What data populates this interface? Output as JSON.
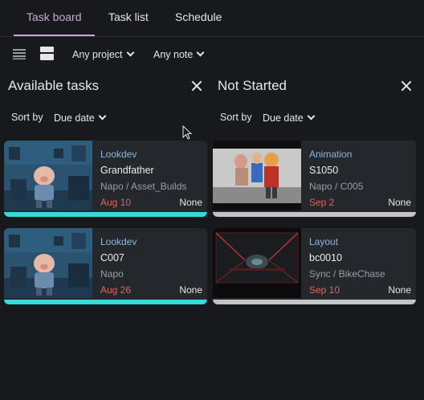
{
  "tabs": [
    {
      "label": "Task board",
      "active": true
    },
    {
      "label": "Task list",
      "active": false
    },
    {
      "label": "Schedule",
      "active": false
    }
  ],
  "toolbar": {
    "project_filter": "Any project",
    "note_filter": "Any note"
  },
  "columns": [
    {
      "title": "Available tasks",
      "sort_label": "Sort by",
      "sort_value": "Due date",
      "cards": [
        {
          "status": "Lookdev",
          "name": "Grandfather",
          "project": "Napo / Asset_Builds",
          "date": "Aug 10",
          "assignee": "None",
          "thumb": "character-pig-room",
          "bar_color": "#38d9d9"
        },
        {
          "status": "Lookdev",
          "name": "C007",
          "project": "Napo",
          "date": "Aug 26",
          "assignee": "None",
          "thumb": "character-pig-room",
          "bar_color": "#38d9d9"
        }
      ]
    },
    {
      "title": "Not Started",
      "sort_label": "Sort by",
      "sort_value": "Due date",
      "cards": [
        {
          "status": "Animation",
          "name": "S1050",
          "project": "Napo / C005",
          "date": "Sep 2",
          "assignee": "None",
          "thumb": "animation-playblast",
          "bar_color": "#c4c4c4"
        },
        {
          "status": "Layout",
          "name": "bc0010",
          "project": "Sync / BikeChase",
          "date": "Sep 10",
          "assignee": "None",
          "thumb": "layout-scifi-frame",
          "bar_color": "#c4c4c4"
        }
      ]
    }
  ],
  "colors": {
    "background": "#17191d",
    "card": "#24272c",
    "accent_tab": "#c9a9d6",
    "status_text": "#8fb6dd",
    "due_date": "#e0655a",
    "available_bar": "#38d9d9",
    "not_started_bar": "#c4c4c4"
  }
}
